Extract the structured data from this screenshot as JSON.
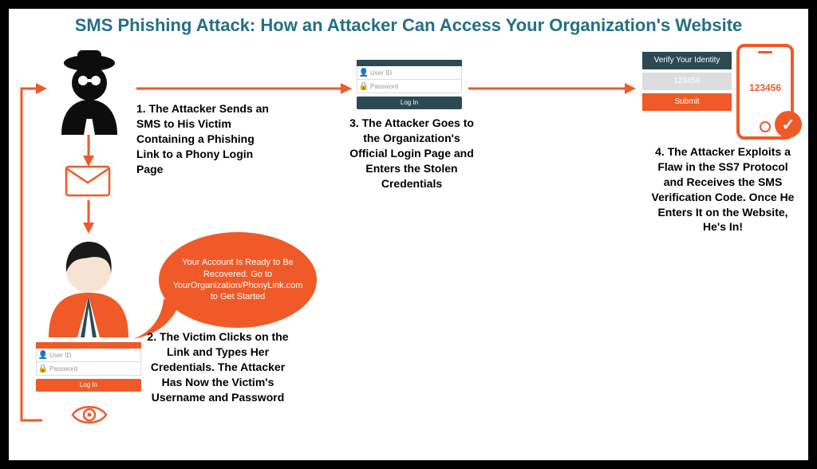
{
  "title": "SMS Phishing Attack: How an Attacker Can Access Your Organization's Website",
  "steps": {
    "s1": "1. The Attacker Sends an SMS to His Victim Containing a Phishing Link to a Phony Login Page",
    "s2": "2. The Victim Clicks on the Link and Types Her Credentials. The Attacker Has Now the Victim's Username and Password",
    "s3": "3. The Attacker Goes to the Organization's Official Login Page and Enters the Stolen Credentials",
    "s4": "4. The Attacker Exploits a Flaw in the SS7 Protocol and Receives the SMS Verification Code. Once He Enters It on the Website, He's In!"
  },
  "bubble": "Your Account Is Ready to Be Recovered. Go to YourOrganization/PhonyLink.com to Get Started",
  "login_small": {
    "user": "User ID",
    "pass": "Password",
    "btn": "Log In"
  },
  "login_dark": {
    "user": "User ID",
    "pass": "Password",
    "btn": "Log In"
  },
  "verify": {
    "head": "Verify Your Identity",
    "code": "123456",
    "submit": "Submit"
  },
  "phone_code": "123456",
  "check": "✓",
  "colors": {
    "accent": "#F05A28",
    "darkTeal": "#2D4A53",
    "title": "#237085"
  }
}
